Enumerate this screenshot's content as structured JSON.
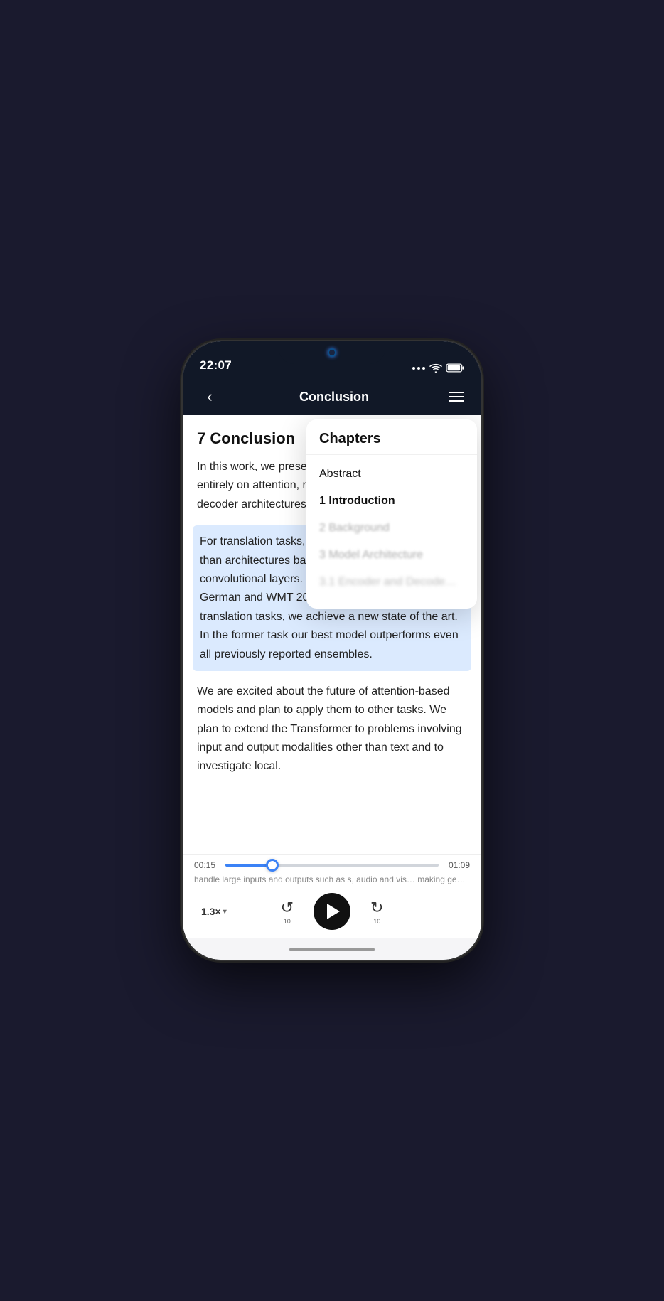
{
  "status": {
    "time": "22:07"
  },
  "nav": {
    "title": "Conclusion",
    "back_label": "‹"
  },
  "content": {
    "chapter_heading": "7 Conclusion",
    "paragraph1": "In this work, we prese… the first sequence tra… entirely on attention, r… layers most commonly… decoder architectures … attention.",
    "paragraph1_full": "In this work, we presented the first sequence transduction model based entirely on attention, replacing the recurrent layers most commonly used in encoder-decoder architectures with multi-headed self-attention.",
    "paragraph2": "For translation tasks, t… trained significantly faster than architectures based on recurrent or convolutional layers. On both WMT 2014 English-to-German and WMT 2014 English-to-French translation tasks, we achieve a new state of the art. In the former task our best model outperforms even all previously reported ensembles.",
    "paragraph3": "We are excited about the future of attention-based models and plan to apply them to other tasks. We plan to extend the Transformer to problems involving input and output modalities other than text and to investigate local.",
    "bottom_peek1": "handle large inputs and outputs such as",
    "bottom_peek2": "s, audio and vis… making generation"
  },
  "chapters": {
    "title": "Chapters",
    "items": [
      {
        "label": "Abstract",
        "state": "normal"
      },
      {
        "label": "1 Introduction",
        "state": "active"
      },
      {
        "label": "2 Background",
        "state": "blurred"
      },
      {
        "label": "3 Model Architecture",
        "state": "blurred"
      },
      {
        "label": "3.1 Encoder and Decoder…",
        "state": "more-blurred"
      }
    ]
  },
  "player": {
    "current_time": "00:15",
    "total_time": "01:09",
    "progress_percent": 22,
    "speed": "1.3×",
    "speed_dropdown": "▾",
    "rewind_label": "10",
    "forward_label": "10",
    "scroll_text": "handle large inputs and outputs such as s, audio and vis… making generation"
  }
}
